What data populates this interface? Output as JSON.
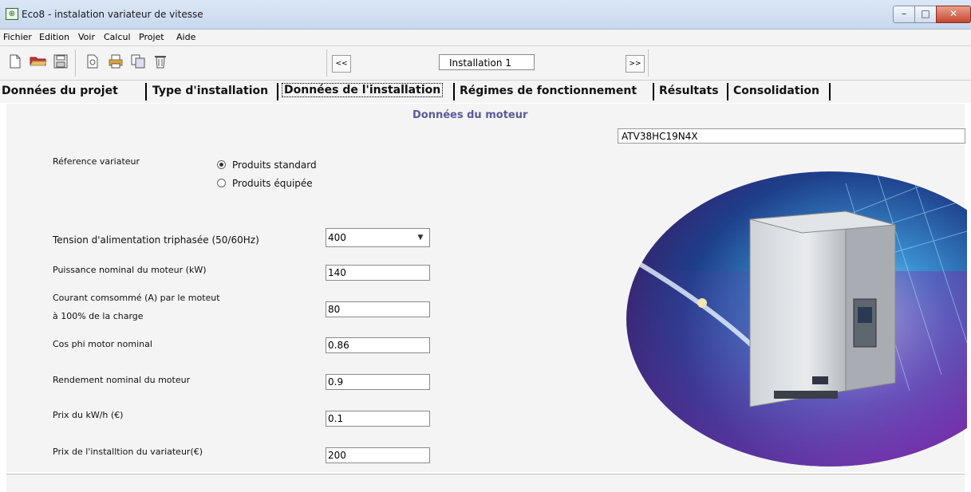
{
  "window": {
    "title": "Eco8 - instalation variateur de vitesse",
    "controls": {
      "minimize": "–",
      "maximize": "□",
      "close": "✕"
    }
  },
  "menu": [
    "Fichier",
    "Edition",
    "Voir",
    "Calcul",
    "Projet",
    "Aide"
  ],
  "toolbar": {
    "icons": [
      "new-file-icon",
      "open-folder-icon",
      "save-icon",
      "print-preview-icon",
      "print-icon",
      "copy-icon",
      "delete-icon"
    ],
    "prev_label": "<<",
    "next_label": ">>",
    "project_name": "Installation 1"
  },
  "tabs": [
    {
      "label": "Données du projet"
    },
    {
      "label": "Type d'installation"
    },
    {
      "label": "Données de l'installation",
      "active": true
    },
    {
      "label": "Régimes de fonctionnement"
    },
    {
      "label": "Résultats"
    },
    {
      "label": "Consolidation"
    }
  ],
  "section_title": "Données du moteur",
  "drive_reference": "ATV38HC19N4X",
  "reference": {
    "label": "Réference variateur",
    "options": [
      {
        "label": "Produits standard",
        "checked": true
      },
      {
        "label": "Produits équipée",
        "checked": false
      }
    ]
  },
  "fields": {
    "tension": {
      "label": "Tension d'alimentation triphasée  (50/60Hz)",
      "value": "400"
    },
    "puissance": {
      "label": "Puissance nominal du moteur (kW)",
      "value": "140"
    },
    "courant": {
      "label_line1": "Courant comsommé (A) par le moteut",
      "label_line2": "à 100% de la charge",
      "value": "80"
    },
    "cosphi": {
      "label": "Cos phi motor nominal",
      "value": "0.86"
    },
    "rendement": {
      "label": "Rendement nominal du moteur",
      "value": "0.9"
    },
    "prix_kwh": {
      "label": "Prix du kW/h (€)",
      "value": "0.1"
    },
    "prix_install": {
      "label": "Prix de l'installtion du variateur(€)",
      "value": "200"
    }
  },
  "colors": {
    "section_title": "#5a5a9a",
    "title_bar": "#c7d8ee",
    "panel_bg": "#f4f4f4"
  }
}
